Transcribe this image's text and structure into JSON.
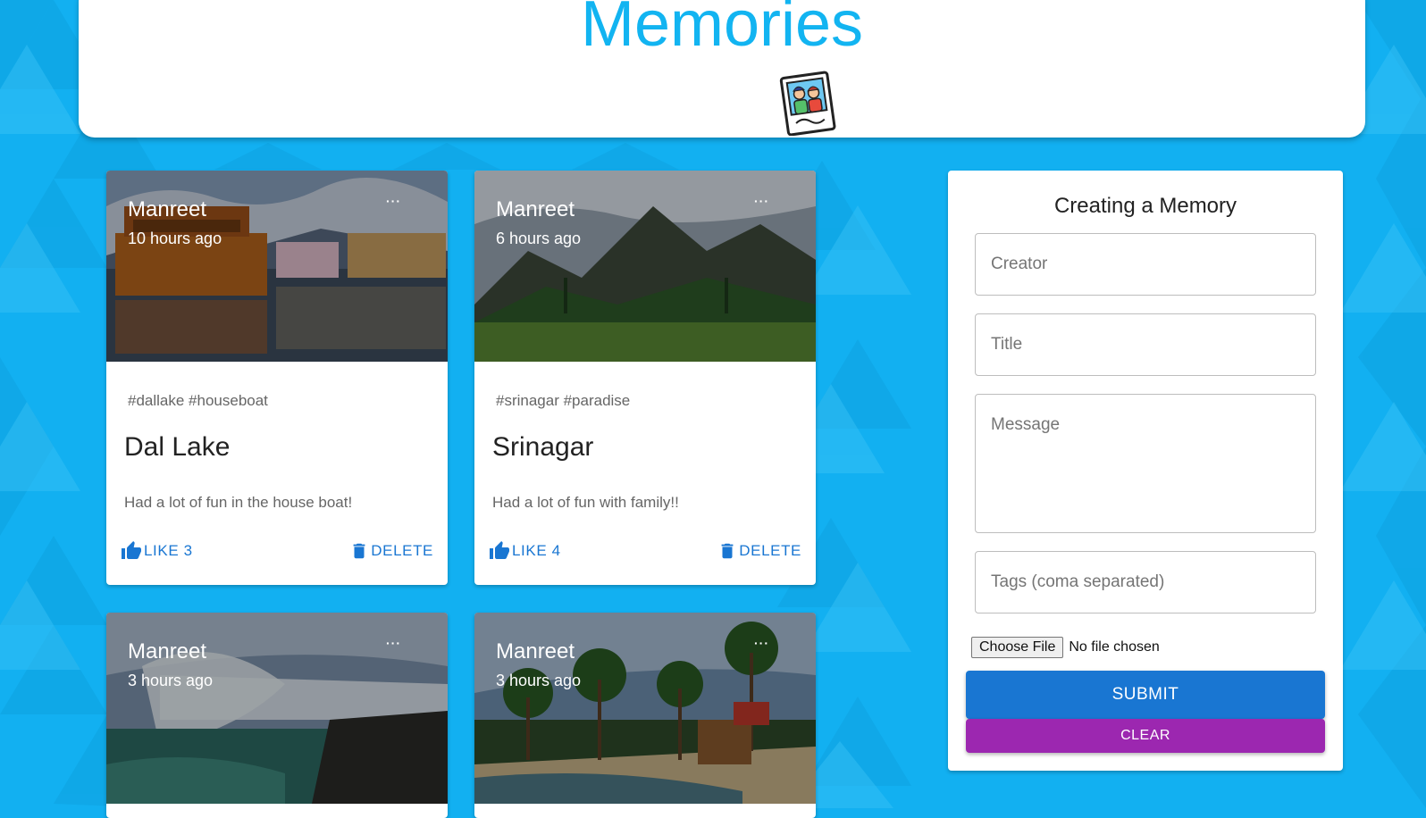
{
  "app": {
    "title": "Memories",
    "logo_icon": "photo-frame-icon",
    "accent_color": "#12b4f1",
    "background_color": "#12b0f1"
  },
  "posts": [
    {
      "creator": "Manreet",
      "time": "10 hours ago",
      "tags": "#dallake #houseboat",
      "title": "Dal Lake",
      "message": "Had a lot of fun in the house boat!",
      "like_label": "LIKE 3",
      "delete_label": "DELETE",
      "more_label": "···"
    },
    {
      "creator": "Manreet",
      "time": "6 hours ago",
      "tags": "#srinagar #paradise",
      "title": "Srinagar",
      "message": "Had a lot of fun with family!!",
      "like_label": "LIKE 4",
      "delete_label": "DELETE",
      "more_label": "···"
    },
    {
      "creator": "Manreet",
      "time": "3 hours ago",
      "more_label": "···"
    },
    {
      "creator": "Manreet",
      "time": "3 hours ago",
      "more_label": "···"
    }
  ],
  "form": {
    "heading": "Creating a Memory",
    "creator_placeholder": "Creator",
    "title_placeholder": "Title",
    "message_placeholder": "Message",
    "tags_placeholder": "Tags (coma separated)",
    "file_button_label": "Choose File",
    "file_status": "No file chosen",
    "submit_label": "SUBMIT",
    "clear_label": "CLEAR",
    "submit_color": "#1976d2",
    "clear_color": "#9c27b0"
  }
}
